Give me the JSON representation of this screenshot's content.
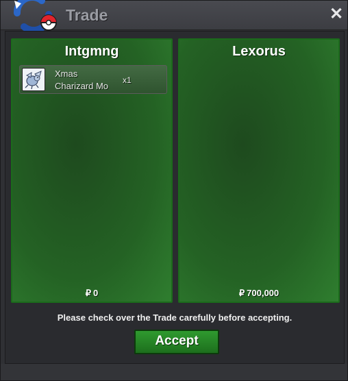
{
  "window": {
    "title": "Trade",
    "close_glyph": "✕"
  },
  "trade": {
    "left": {
      "player": "Intgmng",
      "items": [
        {
          "name_line1": "Xmas",
          "name_line2": "Charizard Mo",
          "qty": "x1",
          "icon": "charizard-icon"
        }
      ],
      "currency_symbol": "₽",
      "money": "0"
    },
    "right": {
      "player": "Lexorus",
      "items": [],
      "currency_symbol": "₽",
      "money": "700,000"
    }
  },
  "notice": "Please check over the Trade carefully before accepting.",
  "accept_label": "Accept",
  "colors": {
    "panel_green": "#246224",
    "panel_border": "#1b6b1b",
    "accept_green": "#2f9a2f",
    "title_text": "#9a9ca3"
  }
}
